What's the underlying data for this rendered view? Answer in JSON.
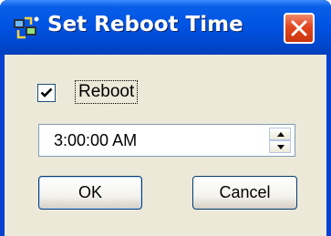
{
  "window": {
    "title": "Set Reboot Time",
    "icon": "app-icon",
    "close_icon": "close-icon"
  },
  "reboot_checkbox": {
    "label": "Reboot",
    "checked": true
  },
  "time_field": {
    "value": "3:00:00 AM",
    "spin_up_icon": "chevron-up-icon",
    "spin_down_icon": "chevron-down-icon"
  },
  "buttons": {
    "ok_label": "OK",
    "cancel_label": "Cancel"
  },
  "colors": {
    "titlebar": "#0054e3",
    "close_button": "#e2461e",
    "dialog_background": "#ece9d8"
  }
}
